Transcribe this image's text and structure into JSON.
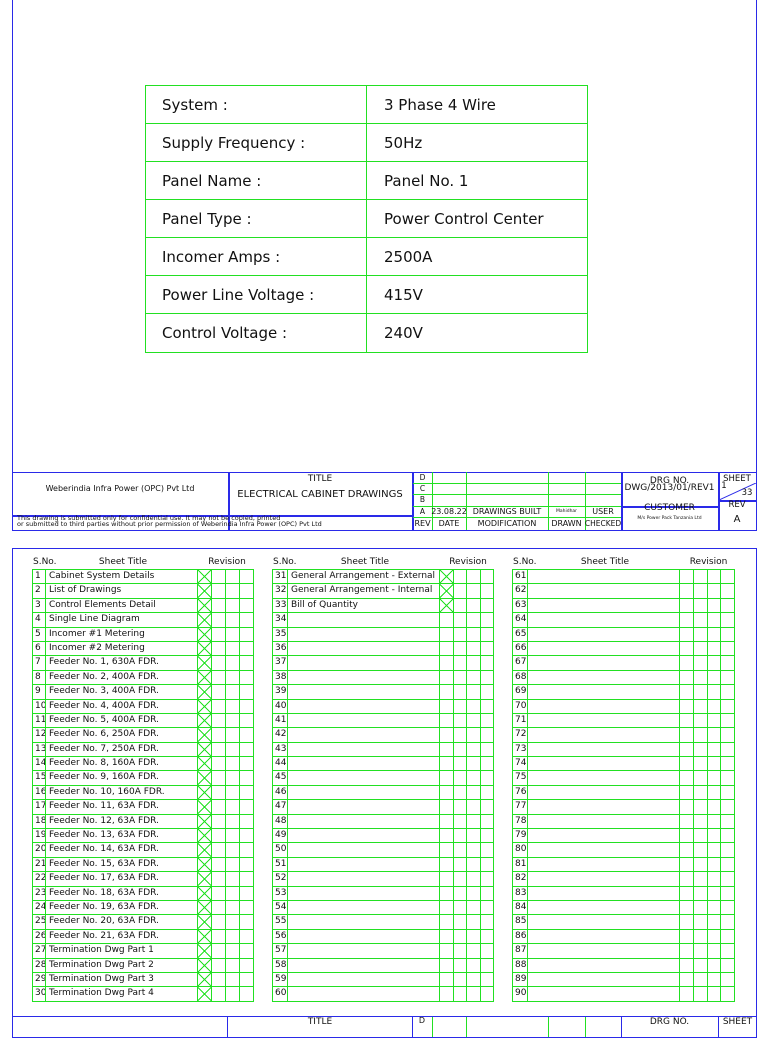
{
  "info": [
    {
      "label": "System :",
      "value": "3 Phase 4 Wire"
    },
    {
      "label": "Supply Frequency :",
      "value": "50Hz"
    },
    {
      "label": "Panel Name :",
      "value": "Panel No. 1"
    },
    {
      "label": "Panel Type :",
      "value": "Power Control Center"
    },
    {
      "label": "Incomer Amps :",
      "value": "2500A"
    },
    {
      "label": "Power Line Voltage :",
      "value": "415V"
    },
    {
      "label": "Control Voltage :",
      "value": "240V"
    }
  ],
  "titleblock": {
    "company": "Weberindia Infra Power (OPC) Pvt Ltd",
    "title_label": "TITLE",
    "title": "ELECTRICAL CABINET DRAWINGS",
    "disclaimer1": "This drawing is submitted only for confidential use. It may not be copied, printed",
    "disclaimer2": "or submitted to third parties without prior permission of Weberindia Infra Power (OPC) Pvt Ltd",
    "rev_letters": [
      "D",
      "C",
      "B",
      "A"
    ],
    "rev_a": {
      "date": "23.08.22",
      "modification": "DRAWINGS BUILT",
      "drawn": "Mahidhar",
      "checked": "USER"
    },
    "col_headers": {
      "rev": "REV",
      "date": "DATE",
      "modification": "MODIFICATION",
      "drawn": "DRAWN",
      "checked": "CHECKED"
    },
    "drg_label": "DRG NO.",
    "drg_no": "DWG/2013/01/REV1",
    "sheet_label": "SHEET",
    "sheet": "1",
    "sheet_total": "33",
    "customer_label": "CUSTOMER",
    "customer": "M/s Power Pack Tanzania Ltd",
    "rev_label": "REV",
    "rev": "A"
  },
  "list_headers": {
    "sno": "S.No.",
    "title": "Sheet Title",
    "revision": "Revision"
  },
  "drawings": [
    "Cabinet System Details",
    "List of Drawings",
    "Control Elements Detail",
    "Single Line Diagram",
    "Incomer #1 Metering",
    "Incomer #2 Metering",
    "Feeder No. 1, 630A FDR.",
    "Feeder No. 2, 400A FDR.",
    "Feeder No. 3, 400A FDR.",
    "Feeder No. 4, 400A FDR.",
    "Feeder No. 5, 400A FDR.",
    "Feeder No. 6, 250A FDR.",
    "Feeder No. 7, 250A FDR.",
    "Feeder No. 8, 160A FDR.",
    "Feeder No. 9, 160A FDR.",
    "Feeder No. 10, 160A FDR.",
    "Feeder No. 11, 63A FDR.",
    "Feeder No. 12, 63A FDR.",
    "Feeder No. 13, 63A FDR.",
    "Feeder No. 14, 63A FDR.",
    "Feeder No. 15, 63A FDR.",
    "Feeder No. 17, 63A FDR.",
    "Feeder No. 18, 63A FDR.",
    "Feeder No. 19, 63A FDR.",
    "Feeder No. 20, 63A FDR.",
    "Feeder No. 21, 63A FDR.",
    "Termination Dwg Part 1",
    "Termination Dwg Part 2",
    "Termination Dwg Part 3",
    "Termination Dwg Part 4",
    "General Arrangement - External",
    "General Arrangement - Internal",
    "Bill of Quantity"
  ],
  "total_rows": 90
}
